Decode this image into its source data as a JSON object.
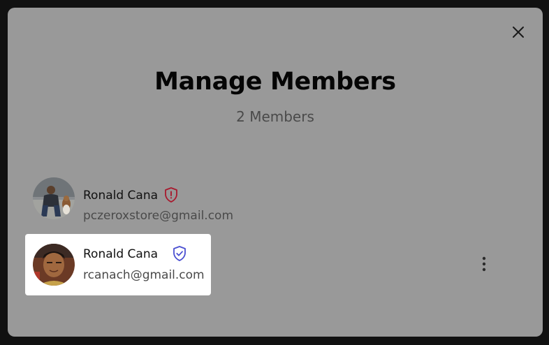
{
  "modal": {
    "title": "Manage Members",
    "subtitle": "2 Members"
  },
  "members": [
    {
      "name": "Ronald Cana",
      "email": "pczeroxstore@gmail.com",
      "role_icon": "shield-alert-icon",
      "role_color": "#a8192e"
    },
    {
      "name": "Ronald Cana",
      "email": "rcanach@gmail.com",
      "role_icon": "shield-check-icon",
      "role_color": "#4a4fd1",
      "selected": true
    }
  ],
  "icons": {
    "close": "close-icon",
    "more": "more-vertical-icon"
  },
  "colors": {
    "overlay_background": "#111111",
    "modal_background": "#999999",
    "selected_row_background": "#ffffff"
  }
}
